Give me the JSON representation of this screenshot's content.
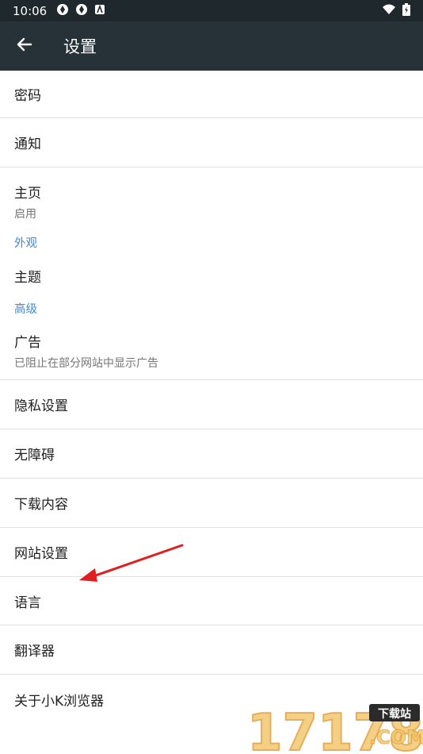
{
  "status_bar": {
    "time": "10:06"
  },
  "app_bar": {
    "title": "设置"
  },
  "items": {
    "password": {
      "title": "密码"
    },
    "notifications": {
      "title": "通知"
    },
    "homepage": {
      "title": "主页",
      "summary": "启用"
    },
    "appearance_header": "外观",
    "theme": {
      "title": "主题"
    },
    "advanced_header": "高级",
    "ads": {
      "title": "广告",
      "summary": "已阻止在部分网站中显示广告"
    },
    "privacy": {
      "title": "隐私设置"
    },
    "accessibility": {
      "title": "无障碍"
    },
    "downloads": {
      "title": "下载内容"
    },
    "site_settings": {
      "title": "网站设置"
    },
    "language": {
      "title": "语言"
    },
    "translator": {
      "title": "翻译器"
    },
    "about": {
      "title": "关于小K浏览器"
    }
  },
  "watermark": {
    "number": "17178",
    "badge": "下载站",
    "suffix": ".COM"
  },
  "colors": {
    "status_bar": "#1f282d",
    "app_bar": "#263238",
    "section_header": "#3f8ad8",
    "annotation_arrow": "#e02020"
  }
}
